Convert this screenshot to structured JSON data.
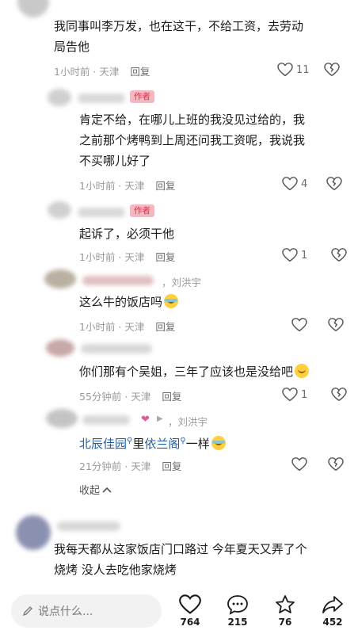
{
  "comments": [
    {
      "text_line1": "我同事叫李万发，也在这干，不给工资，去劳动",
      "text_line2": "局告他",
      "time": "1小时前 · 天津",
      "reply": "回复",
      "likes": "11"
    },
    {
      "author_tag": "作者",
      "text_line1": "肯定不给，在哪儿上班的我没见过给的，我",
      "text_line2": "之前那个烤鸭到上周还问我工资呢，我说我",
      "text_line3": "不买哪儿好了",
      "time": "1小时前 · 天津",
      "reply": "回复",
      "likes": "4"
    },
    {
      "author_tag": "作者",
      "text_line1": "起诉了，必须干他",
      "time": "1小时前 · 天津",
      "reply": "回复",
      "likes": "1"
    },
    {
      "reply_to": "，刘洪宇",
      "text_line1": "这么牛的饭店吗",
      "time": "1小时前 · 天津",
      "reply": "回复",
      "likes": ""
    },
    {
      "text_line1": "你们那有个吴姐，三年了应该也是没给吧",
      "time": "55分钟前 · 天津",
      "reply": "回复",
      "likes": "1"
    },
    {
      "reply_to": "，刘洪宇",
      "link1": "北辰佳园",
      "mid": "里",
      "link2": "依兰阁",
      "tail": "一样",
      "time": "21分钟前 · 天津",
      "reply": "回复",
      "likes": ""
    },
    {
      "text_line1": "我每天都从这家饭店门口路过  今年夏天又弄了个",
      "text_line2": "烧烤  没人去吃他家烧烤"
    }
  ],
  "collapse_label": "收起",
  "bottom_bar": {
    "input_placeholder": "说点什么...",
    "like_count": "764",
    "comment_count": "215",
    "star_count": "76",
    "share_count": "452"
  }
}
